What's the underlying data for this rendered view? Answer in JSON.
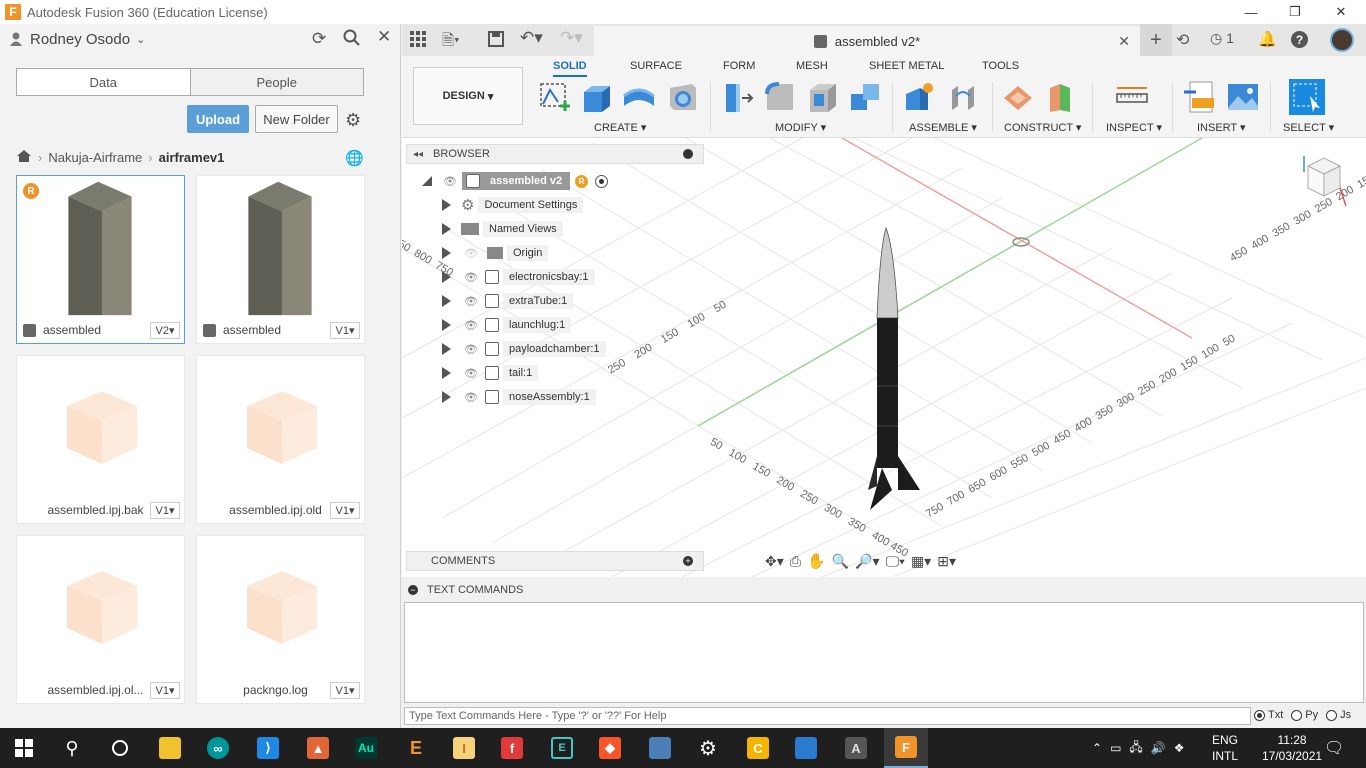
{
  "window": {
    "title": "Autodesk Fusion 360 (Education License)"
  },
  "user": {
    "name": "Rodney Osodo"
  },
  "data_panel": {
    "tabs": [
      "Data",
      "People"
    ],
    "upload": "Upload",
    "new_folder": "New Folder",
    "breadcrumb": [
      "Nakuja-Airframe",
      "airframev1"
    ],
    "files": [
      {
        "name": "assembled",
        "version": "V2"
      },
      {
        "name": "assembled",
        "version": "V1"
      },
      {
        "name": "assembled.ipj.bak",
        "version": "V1"
      },
      {
        "name": "assembled.ipj.old",
        "version": "V1"
      },
      {
        "name": "assembled.ipj.ol...",
        "version": "V1"
      },
      {
        "name": "packngo.log",
        "version": "V1"
      }
    ]
  },
  "doc_tab": {
    "title": "assembled v2*",
    "job_count": "1"
  },
  "ribbon": {
    "workspace": "DESIGN",
    "tabs": [
      "SOLID",
      "SURFACE",
      "FORM",
      "MESH",
      "SHEET METAL",
      "TOOLS"
    ],
    "groups": [
      "CREATE",
      "MODIFY",
      "ASSEMBLE",
      "CONSTRUCT",
      "INSPECT",
      "INSERT",
      "SELECT"
    ]
  },
  "browser": {
    "title": "BROWSER",
    "root": "assembled v2",
    "items": [
      "Document Settings",
      "Named Views",
      "Origin",
      "electronicsbay:1",
      "extraTube:1",
      "launchlug:1",
      "payloadchamber:1",
      "tail:1",
      "noseAssembly:1"
    ]
  },
  "comments": {
    "title": "COMMENTS"
  },
  "text_commands": {
    "title": "TEXT COMMANDS",
    "placeholder": "Type Text Commands Here - Type '?' or '??' For Help",
    "modes": [
      "Txt",
      "Py",
      "Js"
    ]
  },
  "grid_labels": {
    "left": [
      "250",
      "200",
      "150",
      "100",
      "50"
    ],
    "front": [
      "50",
      "100",
      "150",
      "200",
      "250",
      "300",
      "350",
      "400",
      "450"
    ],
    "right": [
      "750",
      "700",
      "650",
      "600",
      "550",
      "500",
      "450",
      "400",
      "350",
      "300",
      "250",
      "200",
      "150",
      "100",
      "50"
    ],
    "far": [
      "450",
      "400",
      "350",
      "300",
      "250",
      "200",
      "150",
      "100",
      "50"
    ],
    "top_left": [
      "50",
      "800",
      "750"
    ]
  },
  "taskbar": {
    "lang": "ENG",
    "layout": "INTL",
    "time": "11:28",
    "date": "17/03/2021"
  },
  "colors": {
    "accent": "#1a6fc0",
    "upload": "#5a9fd8",
    "fusion_orange": "#f09328"
  }
}
